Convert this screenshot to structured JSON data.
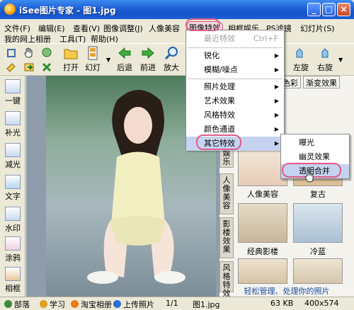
{
  "window": {
    "title": "iSee图片专家 - 图1.jpg"
  },
  "menubar": {
    "row1": [
      "文件(F)",
      "编辑(E)",
      "查看(V)",
      "图像调整(J)",
      "人像美容",
      "图像特效",
      "相框娱乐",
      "PS滤镜",
      "幻灯片(S)"
    ],
    "row2": [
      "我的网上相册",
      "工具(T)",
      "帮助(H)"
    ]
  },
  "toolbar": {
    "open": "打开",
    "slideshow": "幻灯",
    "back": "后退",
    "forward": "前进",
    "zoom": "放大",
    "rotate_left": "左旋",
    "rotate_right": "右旋"
  },
  "left_panel": {
    "items": [
      {
        "label": "一键",
        "icon": "one-click-icon"
      },
      {
        "label": "补光",
        "icon": "fill-light-icon"
      },
      {
        "label": "减光",
        "icon": "reduce-light-icon"
      },
      {
        "label": "文字",
        "icon": "text-icon"
      },
      {
        "label": "水印",
        "icon": "watermark-icon"
      },
      {
        "label": "涂鸦",
        "icon": "graffiti-icon"
      },
      {
        "label": "相框",
        "icon": "frame-icon"
      }
    ]
  },
  "right_panel": {
    "tabs": [
      "色彩",
      "渐变效果"
    ],
    "vtabs": [
      "娱乐",
      "人像美容",
      "影楼效果",
      "风格特效"
    ],
    "thumbs": [
      "人像美容",
      "复古",
      "经典影楼",
      "冷蓝"
    ],
    "footer": "轻松管理、处理你的照片"
  },
  "menu_effects": {
    "items": [
      {
        "label": "最近特效",
        "shortcut": "Ctrl+F",
        "disabled": true,
        "arrow": false
      },
      {
        "label": "锐化",
        "arrow": true
      },
      {
        "label": "模糊/噪点",
        "arrow": true
      },
      {
        "label": "照片处理",
        "arrow": true
      },
      {
        "label": "艺术效果",
        "arrow": true
      },
      {
        "label": "风格特效",
        "arrow": true
      },
      {
        "label": "颜色通道",
        "arrow": true
      },
      {
        "label": "其它特效",
        "arrow": true
      }
    ]
  },
  "menu_other": {
    "items": [
      "曝光",
      "幽灵效果",
      "透明合并"
    ]
  },
  "statusbar": {
    "items": [
      "部落",
      "学习",
      "淘宝相册",
      "上传照片"
    ],
    "page": "1/1",
    "filename": "图1.jpg",
    "size": "63 KB",
    "dimensions": "400x574"
  },
  "colors": {
    "title_gradient": "#1f5fd6",
    "highlight_oval": "#e05c86",
    "menu_highlight": "#c6d3f0",
    "panel_bg": "#ece9d8"
  }
}
